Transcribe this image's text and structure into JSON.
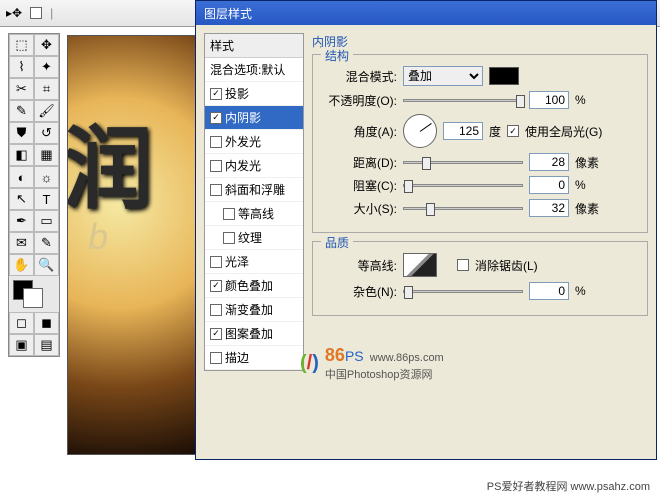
{
  "dialog": {
    "title": "图层样式",
    "styles_header": "样式",
    "blend_options": "混合选项:默认",
    "effects": {
      "drop_shadow": "投影",
      "inner_shadow": "内阴影",
      "outer_glow": "外发光",
      "inner_glow": "内发光",
      "bevel": "斜面和浮雕",
      "contour_sub": "等高线",
      "texture_sub": "纹理",
      "satin": "光泽",
      "color_overlay": "颜色叠加",
      "gradient_overlay": "渐变叠加",
      "pattern_overlay": "图案叠加",
      "stroke": "描边"
    },
    "inner_shadow": {
      "title": "内阴影",
      "structure": "结构",
      "blend_mode_label": "混合模式:",
      "blend_mode_value": "叠加",
      "opacity_label": "不透明度(O):",
      "opacity_value": "100",
      "opacity_unit": "%",
      "angle_label": "角度(A):",
      "angle_value": "125",
      "angle_unit": "度",
      "global_light": "使用全局光(G)",
      "distance_label": "距离(D):",
      "distance_value": "28",
      "distance_unit": "像素",
      "choke_label": "阻塞(C):",
      "choke_value": "0",
      "choke_unit": "%",
      "size_label": "大小(S):",
      "size_value": "32",
      "size_unit": "像素",
      "quality": "品质",
      "contour_label": "等高线:",
      "antialias": "消除锯齿(L)",
      "noise_label": "杂色(N):",
      "noise_value": "0",
      "noise_unit": "%"
    }
  },
  "canvas": {
    "main_text": "润",
    "sub_text": "b"
  },
  "watermark": {
    "site": "www.86ps.com",
    "brand_num": "86",
    "brand_suffix": "PS",
    "tagline": "中国Photoshop资源网"
  },
  "footer": "PS爱好者教程网 www.psahz.com"
}
